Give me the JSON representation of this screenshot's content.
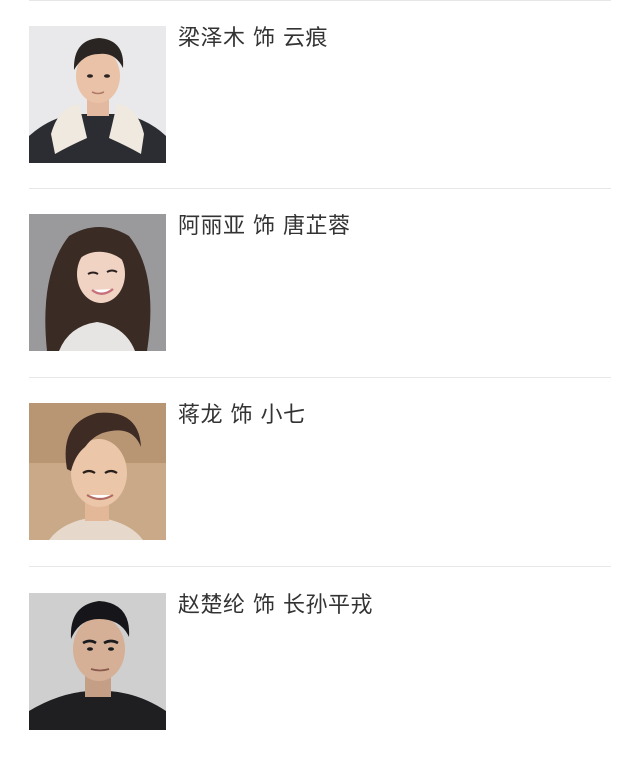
{
  "cast_list": {
    "items": [
      {
        "caption": "梁泽木 饰 云痕"
      },
      {
        "caption": "阿丽亚 饰 唐芷蓉"
      },
      {
        "caption": "蒋龙 饰 小七"
      },
      {
        "caption": "赵楚纶 饰 长孙平戎"
      }
    ]
  }
}
